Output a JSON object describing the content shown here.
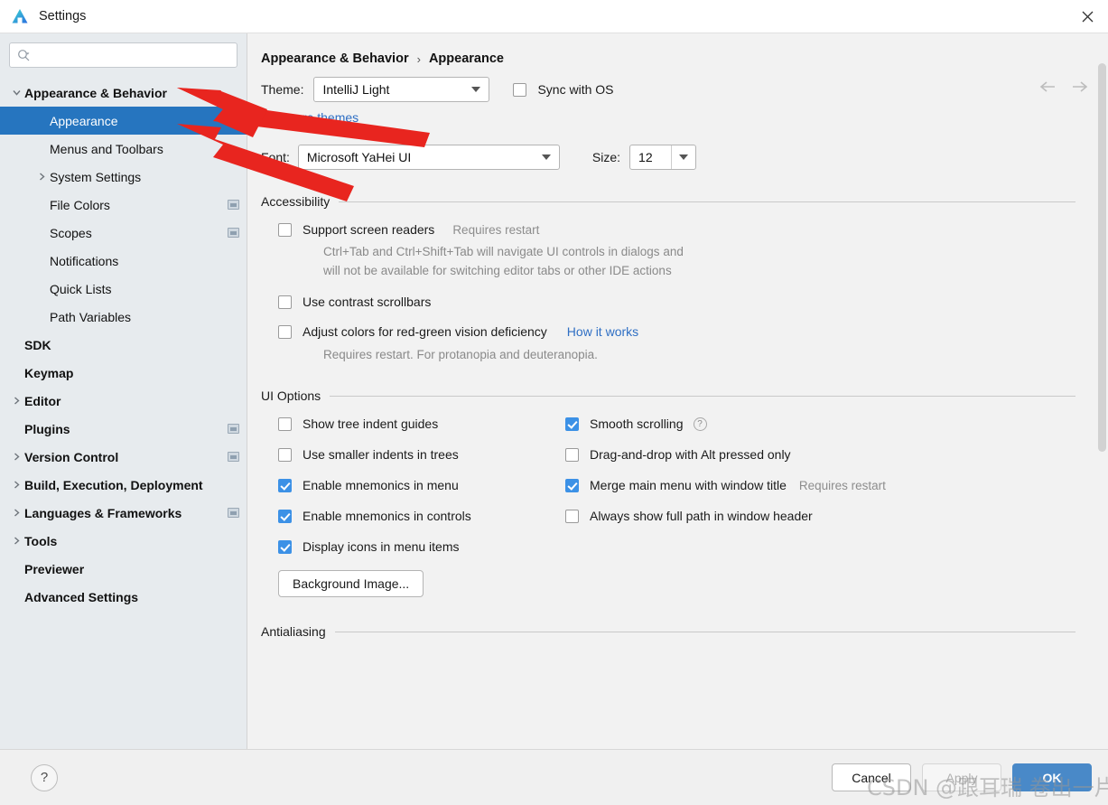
{
  "window": {
    "title": "Settings",
    "logo_icon": "android-studio-logo-icon",
    "close_icon": "close-icon"
  },
  "sidebar": {
    "search": {
      "placeholder": "",
      "value": "",
      "icon": "search-icon"
    },
    "items": [
      {
        "label": "Appearance & Behavior",
        "indent": 0,
        "arrow": "expanded",
        "bold": true,
        "selected": false,
        "project_icon": false
      },
      {
        "label": "Appearance",
        "indent": 1,
        "arrow": "none",
        "bold": false,
        "selected": true,
        "project_icon": false
      },
      {
        "label": "Menus and Toolbars",
        "indent": 1,
        "arrow": "none",
        "bold": false,
        "selected": false,
        "project_icon": false
      },
      {
        "label": "System Settings",
        "indent": 1,
        "arrow": "collapsed",
        "bold": false,
        "selected": false,
        "project_icon": false
      },
      {
        "label": "File Colors",
        "indent": 1,
        "arrow": "none",
        "bold": false,
        "selected": false,
        "project_icon": true
      },
      {
        "label": "Scopes",
        "indent": 1,
        "arrow": "none",
        "bold": false,
        "selected": false,
        "project_icon": true
      },
      {
        "label": "Notifications",
        "indent": 1,
        "arrow": "none",
        "bold": false,
        "selected": false,
        "project_icon": false
      },
      {
        "label": "Quick Lists",
        "indent": 1,
        "arrow": "none",
        "bold": false,
        "selected": false,
        "project_icon": false
      },
      {
        "label": "Path Variables",
        "indent": 1,
        "arrow": "none",
        "bold": false,
        "selected": false,
        "project_icon": false
      },
      {
        "label": "SDK",
        "indent": 0,
        "arrow": "none",
        "bold": true,
        "selected": false,
        "project_icon": false
      },
      {
        "label": "Keymap",
        "indent": 0,
        "arrow": "none",
        "bold": true,
        "selected": false,
        "project_icon": false
      },
      {
        "label": "Editor",
        "indent": 0,
        "arrow": "collapsed",
        "bold": true,
        "selected": false,
        "project_icon": false
      },
      {
        "label": "Plugins",
        "indent": 0,
        "arrow": "none",
        "bold": true,
        "selected": false,
        "project_icon": true
      },
      {
        "label": "Version Control",
        "indent": 0,
        "arrow": "collapsed",
        "bold": true,
        "selected": false,
        "project_icon": true
      },
      {
        "label": "Build, Execution, Deployment",
        "indent": 0,
        "arrow": "collapsed",
        "bold": true,
        "selected": false,
        "project_icon": false
      },
      {
        "label": "Languages & Frameworks",
        "indent": 0,
        "arrow": "collapsed",
        "bold": true,
        "selected": false,
        "project_icon": true
      },
      {
        "label": "Tools",
        "indent": 0,
        "arrow": "collapsed",
        "bold": true,
        "selected": false,
        "project_icon": false
      },
      {
        "label": "Previewer",
        "indent": 0,
        "arrow": "none",
        "bold": true,
        "selected": false,
        "project_icon": false
      },
      {
        "label": "Advanced Settings",
        "indent": 0,
        "arrow": "none",
        "bold": true,
        "selected": false,
        "project_icon": false
      }
    ]
  },
  "main": {
    "breadcrumb": {
      "parent": "Appearance & Behavior",
      "separator": "›",
      "current": "Appearance"
    },
    "nav": {
      "back_icon": "arrow-left-icon",
      "forward_icon": "arrow-right-icon"
    },
    "theme": {
      "label": "Theme:",
      "value": "IntelliJ Light",
      "sync_label": "Sync with OS",
      "sync_checked": false,
      "get_more_link": "Get more themes"
    },
    "font": {
      "label": "Font:",
      "value": "Microsoft YaHei UI",
      "size_label": "Size:",
      "size_value": "12"
    },
    "accessibility": {
      "title": "Accessibility",
      "screen_readers": {
        "label": "Support screen readers",
        "note": "Requires restart",
        "checked": false,
        "desc_line1": "Ctrl+Tab and Ctrl+Shift+Tab will navigate UI controls in dialogs and",
        "desc_line2": "will not be available for switching editor tabs or other IDE actions"
      },
      "contrast_scrollbars": {
        "label": "Use contrast scrollbars",
        "checked": false
      },
      "red_green": {
        "label": "Adjust colors for red-green vision deficiency",
        "link": "How it works",
        "checked": false,
        "desc": "Requires restart. For protanopia and deuteranopia."
      }
    },
    "ui_options": {
      "title": "UI Options",
      "left": [
        {
          "label": "Show tree indent guides",
          "checked": false
        },
        {
          "label": "Use smaller indents in trees",
          "checked": false
        },
        {
          "label": "Enable mnemonics in menu",
          "checked": true
        },
        {
          "label": "Enable mnemonics in controls",
          "checked": true
        },
        {
          "label": "Display icons in menu items",
          "checked": true
        }
      ],
      "right": [
        {
          "label": "Smooth scrolling",
          "checked": true,
          "help": true,
          "note": ""
        },
        {
          "label": "Drag-and-drop with Alt pressed only",
          "checked": false,
          "help": false,
          "note": ""
        },
        {
          "label": "Merge main menu with window title",
          "checked": true,
          "help": false,
          "note": "Requires restart"
        },
        {
          "label": "Always show full path in window header",
          "checked": false,
          "help": false,
          "note": ""
        }
      ],
      "background_image_button": "Background Image..."
    },
    "antialiasing": {
      "title": "Antialiasing"
    }
  },
  "footer": {
    "help_label": "?",
    "cancel_label": "Cancel",
    "apply_label": "Apply",
    "ok_label": "OK"
  },
  "watermark": {
    "text": "CSDN @跟耳瑞 卷出一片天"
  },
  "colors": {
    "accent": "#2675bf",
    "checkbox_checked": "#3c91e6",
    "link": "#2f6fc4",
    "sidebar_bg": "#e7ebee",
    "main_bg": "#f2f2f2",
    "primary_button": "#4989c8",
    "annotation_red": "#e8251f"
  }
}
